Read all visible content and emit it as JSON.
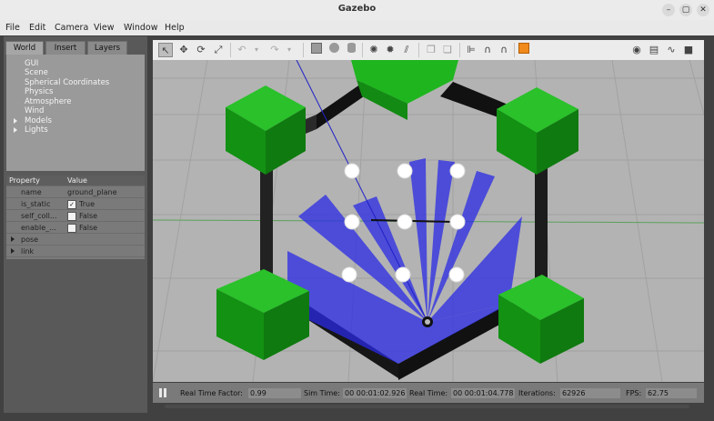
{
  "window": {
    "title": "Gazebo"
  },
  "menu": [
    "File",
    "Edit",
    "Camera",
    "View",
    "Window",
    "Help"
  ],
  "left_panel": {
    "tabs": [
      "World",
      "Insert",
      "Layers"
    ],
    "tree": [
      "GUI",
      "Scene",
      "Spherical Coordinates",
      "Physics",
      "Atmosphere",
      "Wind",
      "Models",
      "Lights"
    ],
    "props_header": {
      "property": "Property",
      "value": "Value"
    },
    "props": [
      {
        "key": "name",
        "value": "ground_plane"
      },
      {
        "key": "is_static",
        "value": "True",
        "checked": true
      },
      {
        "key": "self_coll...",
        "value": "False",
        "checked": false
      },
      {
        "key": "enable_...",
        "value": "False",
        "checked": false
      },
      {
        "key": "pose",
        "value": ""
      },
      {
        "key": "link",
        "value": ""
      }
    ]
  },
  "status": {
    "rtf_label": "Real Time Factor:",
    "rtf_value": "0.99",
    "sim_label": "Sim Time:",
    "sim_value": "00 00:01:02.926",
    "real_label": "Real Time:",
    "real_value": "00 00:01:04.778",
    "iter_label": "Iterations:",
    "iter_value": "62926",
    "fps_label": "FPS:",
    "fps_value": "62.75"
  },
  "colors": {
    "laser": "#2a2ae6",
    "box": "#1fb51f",
    "wall": "#1a1a1a",
    "ground": "#b3b3b3"
  }
}
